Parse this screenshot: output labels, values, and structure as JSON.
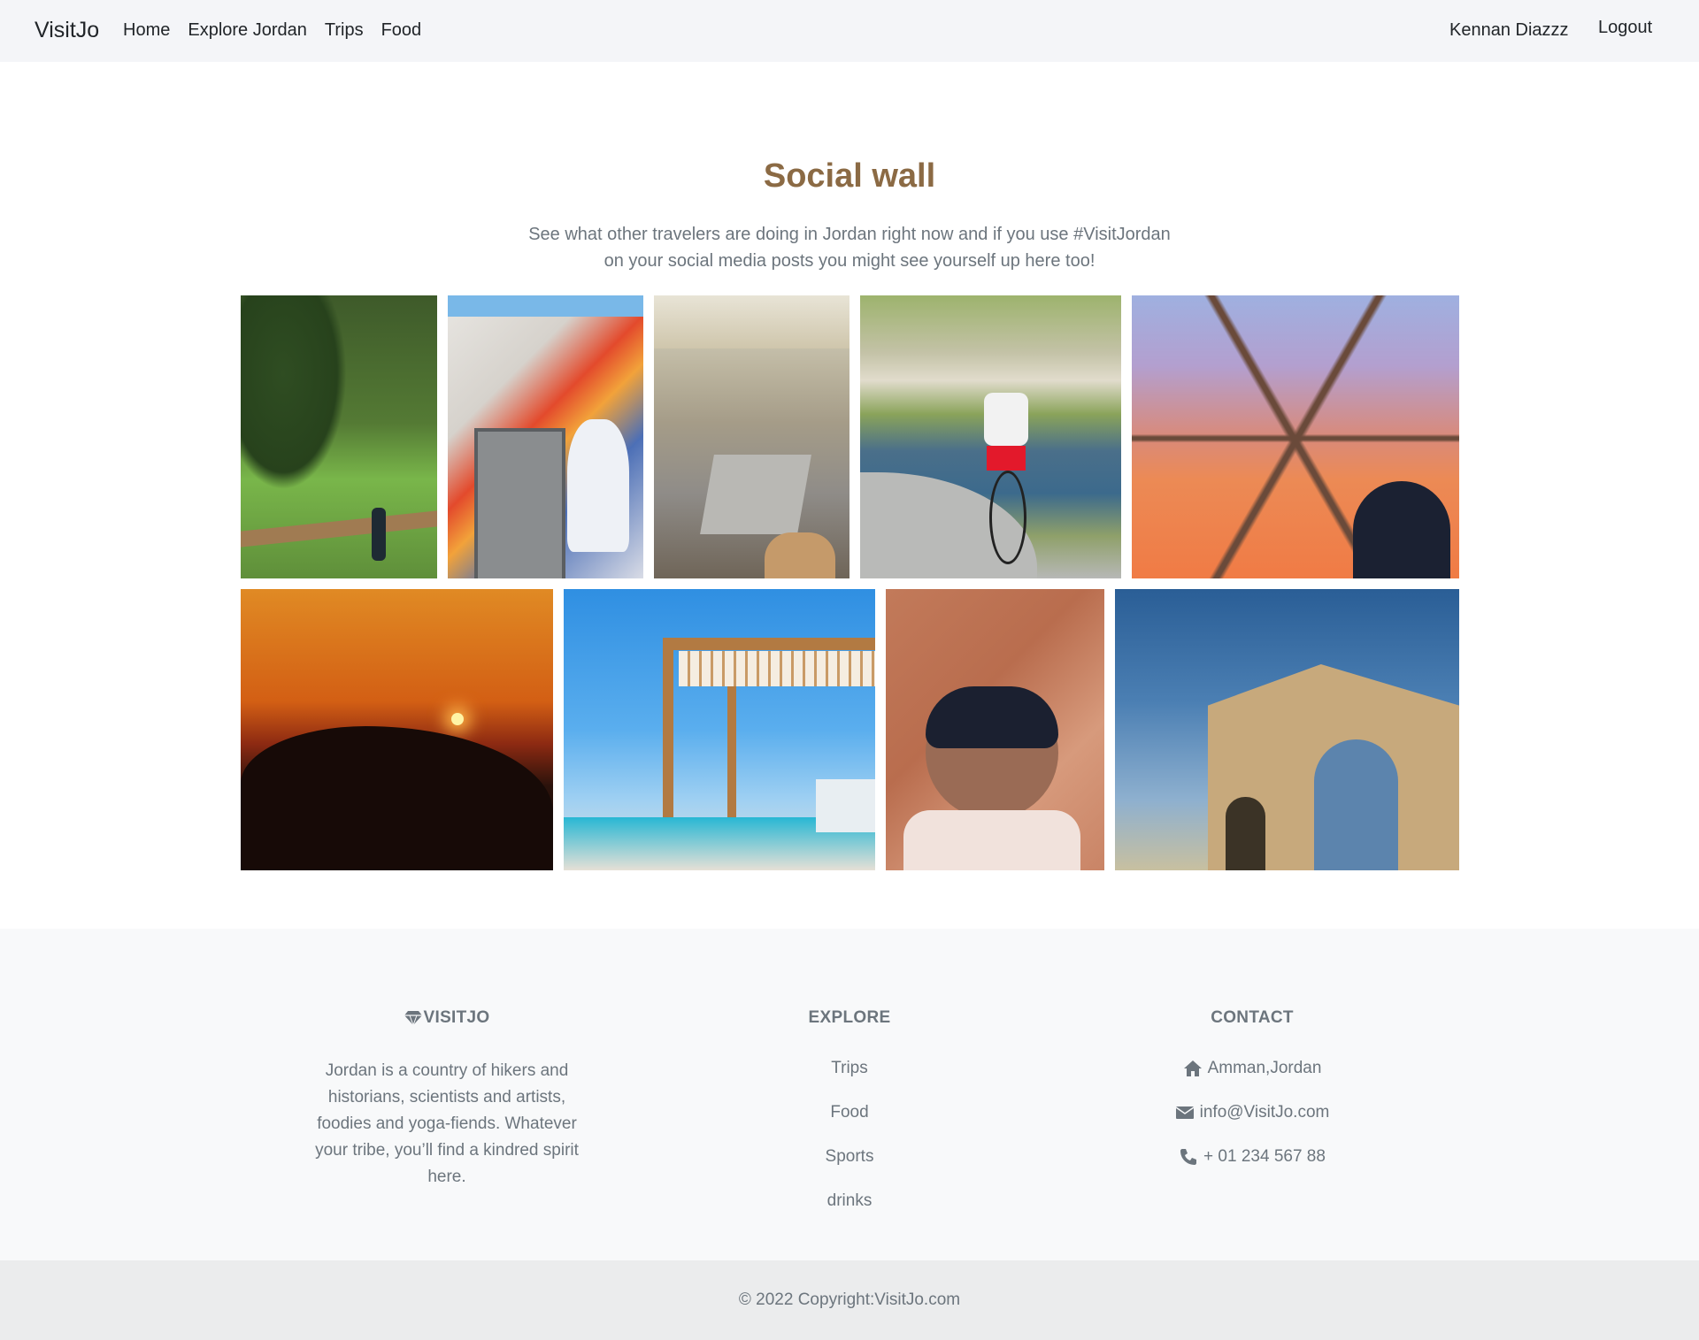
{
  "nav": {
    "brand": "VisitJo",
    "links": [
      "Home",
      "Explore Jordan",
      "Trips",
      "Food"
    ],
    "user": "Kennan Diazzz",
    "logout": "Logout"
  },
  "hero": {
    "title": "Social wall",
    "subtitle_line1": "See what other travelers are doing in Jordan right now and if you use #VisitJordan",
    "subtitle_line2": "on your social media posts you might see yourself up here too!"
  },
  "footer": {
    "about": {
      "title": "VISITJO",
      "text": "Jordan is a country of hikers and historians, scientists and artists, foodies and yoga-fiends. Whatever your tribe, you’ll find a kindred spirit here."
    },
    "explore": {
      "title": "EXPLORE",
      "links": [
        "Trips",
        "Food",
        "Sports",
        "drinks"
      ]
    },
    "contact": {
      "title": "CONTACT",
      "address": "Amman,Jordan",
      "email": "info@VisitJo.com",
      "phone": "+ 01 234 567 88"
    },
    "copyright": "© 2022 Copyright:VisitJo.com"
  },
  "colors": {
    "title": "#8b6a44",
    "muted": "#6c757d",
    "nav_bg": "#f4f5f8",
    "footer_bg": "#f8f9fa",
    "copyright_bg": "#ebeced"
  }
}
